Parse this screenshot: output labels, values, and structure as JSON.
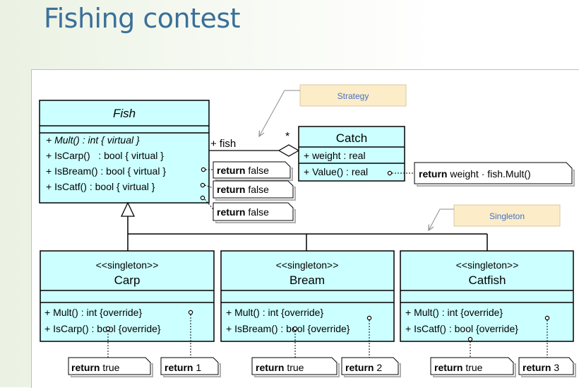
{
  "slide": {
    "title": "Fishing contest"
  },
  "patterns": {
    "strategy": "Strategy",
    "singleton": "Singleton"
  },
  "fish": {
    "name": "Fish",
    "methods": [
      "+ Mult() : int { virtual }",
      "+ IsCarp()   : bool { virtual }",
      "+ IsBream() : bool { virtual }",
      "+ IsCatf() : bool { virtual }"
    ]
  },
  "association": {
    "role": "+ fish",
    "multiplicity": "*"
  },
  "catch": {
    "name": "Catch",
    "attributes": [
      "+ weight : real"
    ],
    "methods": [
      "+ Value() : real"
    ]
  },
  "notes": {
    "fish_false_keyword": "return",
    "fish_false_value": "false",
    "value_keyword": "return",
    "value_expr": "weight · fish.Mult()"
  },
  "subclasses": [
    {
      "stereotype": "<<singleton>>",
      "name": "Carp",
      "methods": [
        "+ Mult() : int {override}",
        "+ IsCarp() : bool {override}"
      ],
      "note_true": "true",
      "note_mult": "1"
    },
    {
      "stereotype": "<<singleton>>",
      "name": "Bream",
      "methods": [
        "+ Mult() : int {override}",
        "+ IsBream() : bool {override}"
      ],
      "note_true": "true",
      "note_mult": "2"
    },
    {
      "stereotype": "<<singleton>>",
      "name": "Catfish",
      "methods": [
        "+ Mult() : int {override}",
        "+ IsCatf() : bool {override}"
      ],
      "note_true": "true",
      "note_mult": "3"
    }
  ],
  "colors": {
    "class_fill": "#ccffff",
    "pattern_fill": "#fdecc8",
    "pattern_text": "#4472c4",
    "title": "#3b6f99"
  }
}
